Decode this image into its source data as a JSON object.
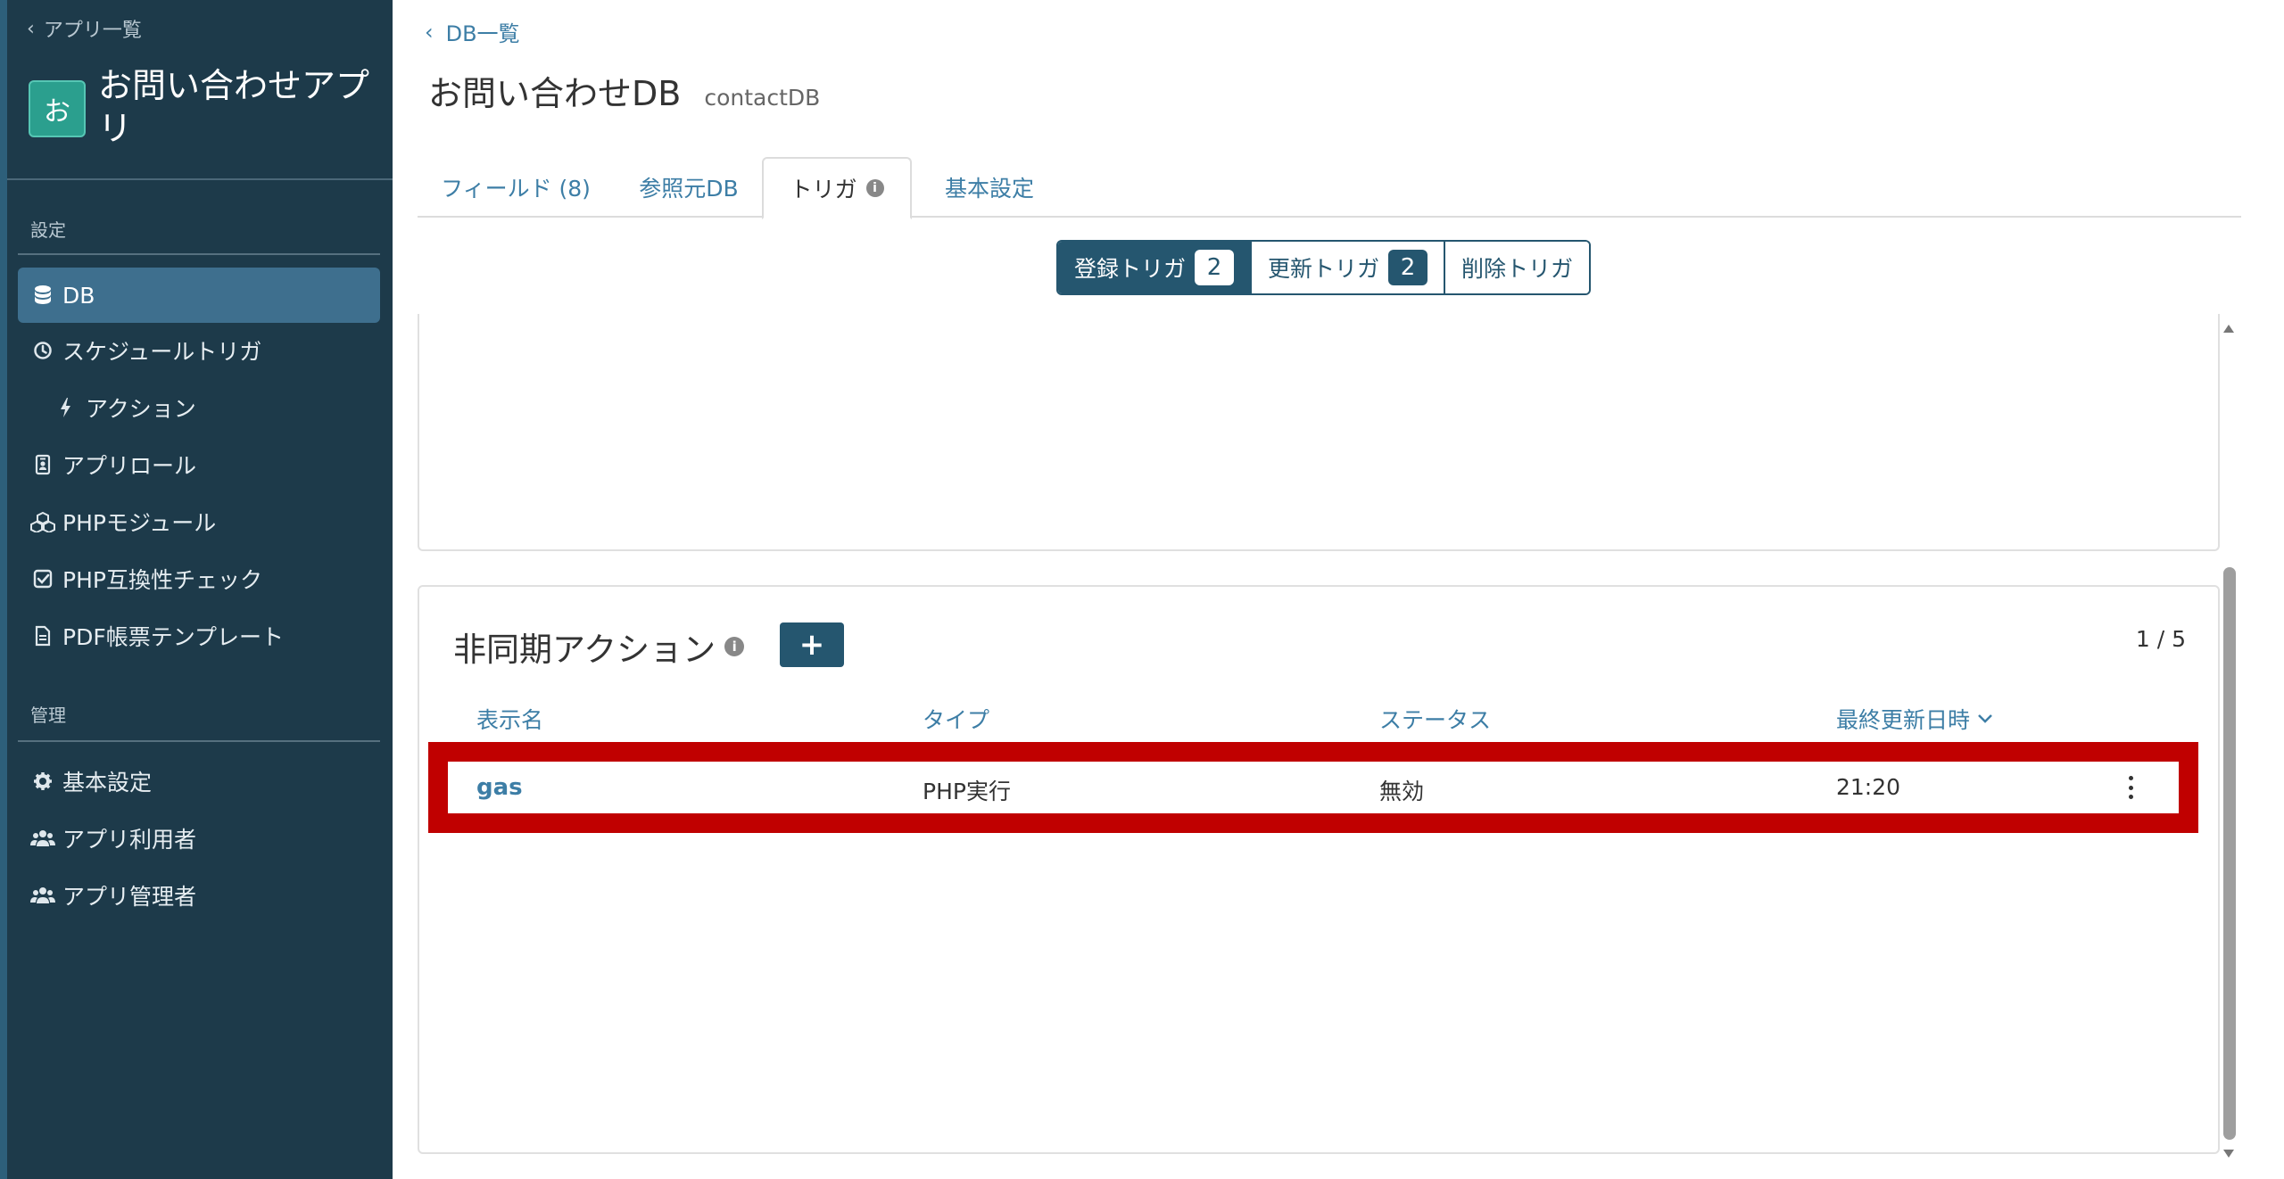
{
  "sidebar": {
    "back_label": "アプリ一覧",
    "app_icon_char": "お",
    "app_title": "お問い合わせアプリ",
    "section_settings": "設定",
    "section_admin": "管理",
    "items": [
      {
        "label": "DB",
        "icon": "database-icon",
        "active": true
      },
      {
        "label": "スケジュールトリガ",
        "icon": "clock-icon"
      },
      {
        "label": "アクション",
        "icon": "bolt-icon"
      },
      {
        "label": "アプリロール",
        "icon": "id-badge-icon"
      },
      {
        "label": "PHPモジュール",
        "icon": "cubes-icon"
      },
      {
        "label": "PHP互換性チェック",
        "icon": "check-square-icon"
      },
      {
        "label": "PDF帳票テンプレート",
        "icon": "file-icon"
      }
    ],
    "admin_items": [
      {
        "label": "基本設定",
        "icon": "gear-icon"
      },
      {
        "label": "アプリ利用者",
        "icon": "users-icon"
      },
      {
        "label": "アプリ管理者",
        "icon": "users-icon"
      }
    ]
  },
  "main": {
    "breadcrumb": "DB一覧",
    "title": "お問い合わせDB",
    "title_sub": "contactDB",
    "tabs": [
      {
        "label": "フィールド (8)"
      },
      {
        "label": "参照元DB"
      },
      {
        "label": "トリガ",
        "active": true
      },
      {
        "label": "基本設定"
      }
    ],
    "trigger_segments": [
      {
        "label": "登録トリガ",
        "count": "2",
        "active": true
      },
      {
        "label": "更新トリガ",
        "count": "2"
      },
      {
        "label": "削除トリガ"
      }
    ],
    "async_actions": {
      "title": "非同期アクション",
      "add_button": "+",
      "pager": "1 / 5",
      "columns": [
        "表示名",
        "タイプ",
        "ステータス",
        "最終更新日時"
      ],
      "rows": [
        {
          "name": "gas",
          "type": "PHP実行",
          "status": "無効",
          "updated": "21:20"
        }
      ]
    }
  },
  "colors": {
    "sidebar_bg": "#1d3a4a",
    "sidebar_active": "#3e6f8e",
    "accent": "#25566f",
    "link": "#3d7ea6",
    "highlight": "#c00000"
  }
}
